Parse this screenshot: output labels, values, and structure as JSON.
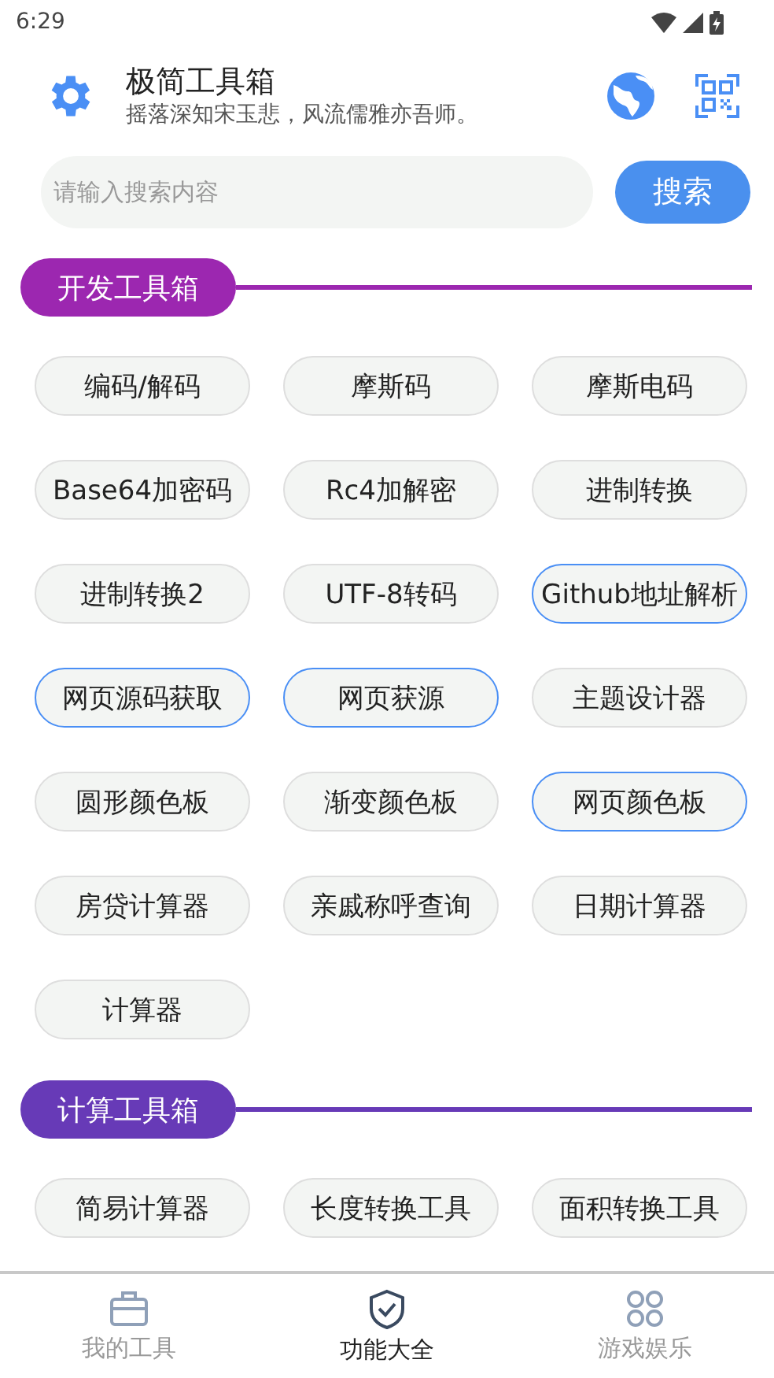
{
  "status_bar": {
    "time": "6:29"
  },
  "header": {
    "title": "极简工具箱",
    "subtitle": "摇落深知宋玉悲，风流儒雅亦吾师。"
  },
  "search": {
    "placeholder": "请输入搜索内容",
    "button": "搜索"
  },
  "sections": [
    {
      "title": "开发工具箱",
      "color": "#9c27b0",
      "tools": [
        {
          "label": "编码/解码",
          "highlighted": false
        },
        {
          "label": "摩斯码",
          "highlighted": false
        },
        {
          "label": "摩斯电码",
          "highlighted": false
        },
        {
          "label": "Base64加密码",
          "highlighted": false
        },
        {
          "label": "Rc4加解密",
          "highlighted": false
        },
        {
          "label": "进制转换",
          "highlighted": false
        },
        {
          "label": "进制转换2",
          "highlighted": false
        },
        {
          "label": "UTF-8转码",
          "highlighted": false
        },
        {
          "label": "Github地址解析",
          "highlighted": true
        },
        {
          "label": "网页源码获取",
          "highlighted": true
        },
        {
          "label": "网页获源",
          "highlighted": true
        },
        {
          "label": "主题设计器",
          "highlighted": false
        },
        {
          "label": "圆形颜色板",
          "highlighted": false
        },
        {
          "label": "渐变颜色板",
          "highlighted": false
        },
        {
          "label": "网页颜色板",
          "highlighted": true
        },
        {
          "label": "房贷计算器",
          "highlighted": false
        },
        {
          "label": "亲戚称呼查询",
          "highlighted": false
        },
        {
          "label": "日期计算器",
          "highlighted": false
        },
        {
          "label": "计算器",
          "highlighted": false
        }
      ]
    },
    {
      "title": "计算工具箱",
      "color": "#673ab7",
      "tools": [
        {
          "label": "简易计算器",
          "highlighted": false
        },
        {
          "label": "长度转换工具",
          "highlighted": false
        },
        {
          "label": "面积转换工具",
          "highlighted": false
        }
      ]
    }
  ],
  "bottom_nav": [
    {
      "kind": "toolbox",
      "label": "我的工具",
      "selected": false
    },
    {
      "kind": "shield",
      "label": "功能大全",
      "selected": true
    },
    {
      "kind": "grid",
      "label": "游戏娱乐",
      "selected": false
    }
  ]
}
